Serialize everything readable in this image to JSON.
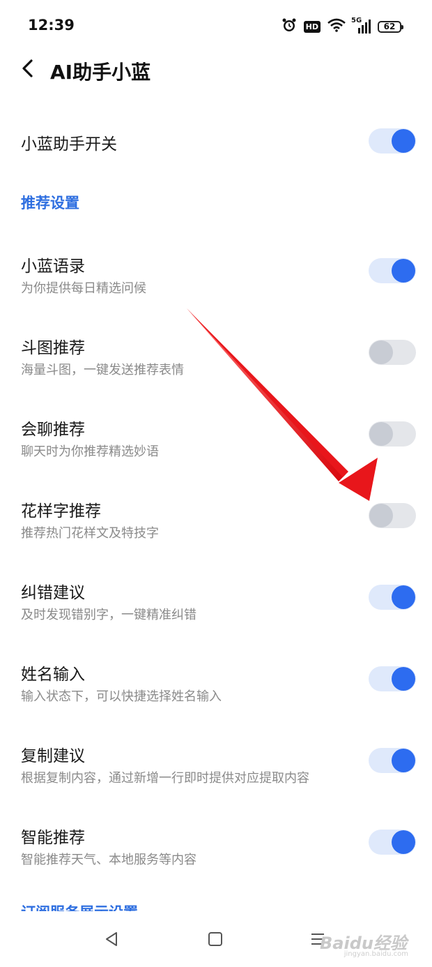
{
  "status_bar": {
    "time": "12:39",
    "icons": [
      "alarm-icon",
      "hd-icon",
      "wifi-icon",
      "5g-signal-icon",
      "battery-icon"
    ],
    "hd_label": "HD",
    "network_label": "5G",
    "battery_level": "62"
  },
  "header": {
    "title": "AI助手小蓝"
  },
  "master_toggle": {
    "label": "小蓝助手开关",
    "enabled": true
  },
  "section_recommend": {
    "title": "推荐设置"
  },
  "settings": [
    {
      "title": "小蓝语录",
      "subtitle": "为你提供每日精选问候",
      "enabled": true
    },
    {
      "title": "斗图推荐",
      "subtitle": "海量斗图，一键发送推荐表情",
      "enabled": false
    },
    {
      "title": "会聊推荐",
      "subtitle": "聊天时为你推荐精选妙语",
      "enabled": false
    },
    {
      "title": "花样字推荐",
      "subtitle": "推荐热门花样文及特技字",
      "enabled": false
    },
    {
      "title": "纠错建议",
      "subtitle": "及时发现错别字，一键精准纠错",
      "enabled": true
    },
    {
      "title": "姓名输入",
      "subtitle": "输入状态下，可以快捷选择姓名输入",
      "enabled": true
    },
    {
      "title": "复制建议",
      "subtitle": "根据复制内容，通过新增一行即时提供对应提取内容",
      "enabled": true
    },
    {
      "title": "智能推荐",
      "subtitle": "智能推荐天气、本地服务等内容",
      "enabled": true
    }
  ],
  "section_subscription": {
    "title": "订阅服务展示设置"
  },
  "nav_bar": {
    "icons": [
      "back-triangle-icon",
      "home-square-icon",
      "menu-lines-icon"
    ]
  },
  "watermark": {
    "text": "Baidu经验",
    "sub": "jingyan.baidu.com"
  },
  "colors": {
    "accent": "#2d6cf0",
    "toggle_on_track": "#dfe9fb",
    "toggle_off_track": "#e4e6ea",
    "toggle_off_knob": "#c8ccd4",
    "section_header": "#2f6fe0",
    "annotation_arrow": "#e8161b"
  }
}
